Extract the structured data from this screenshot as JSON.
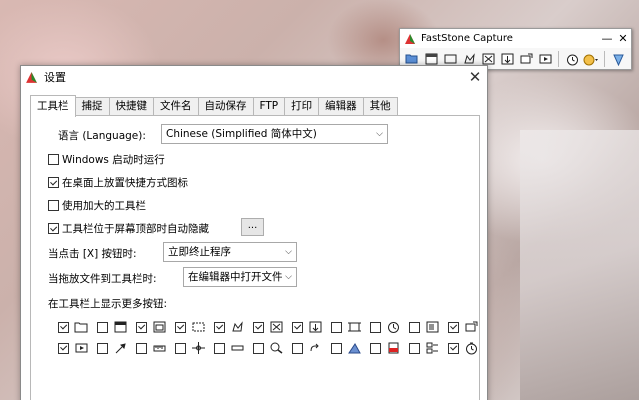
{
  "toolbar_window": {
    "title": "FastStone Capture",
    "min_btn": "—",
    "close_btn": "✕",
    "tools": [
      "open-icon",
      "capture-window-icon",
      "capture-rect-icon",
      "capture-freehand-icon",
      "capture-fullscreen-icon",
      "capture-scroll-icon",
      "capture-fixed-icon",
      "capture-video-icon",
      "timer-icon",
      "output-icon",
      "settings-icon"
    ]
  },
  "dialog": {
    "title": "设置",
    "close": "✕",
    "tabs": [
      "工具栏",
      "捕捉",
      "快捷键",
      "文件名",
      "自动保存",
      "FTP",
      "打印",
      "编辑器",
      "其他"
    ],
    "active_tab": 0,
    "language_label": "语言 (Language):",
    "language_value": "Chinese (Simplified 简体中文)",
    "options": [
      {
        "label": "Windows 启动时运行",
        "checked": false
      },
      {
        "label": "在桌面上放置快捷方式图标",
        "checked": true
      },
      {
        "label": "使用加大的工具栏",
        "checked": false
      },
      {
        "label": "工具栏位于屏幕顶部时自动隐藏",
        "checked": true
      }
    ],
    "more_button": "...",
    "click_x_label": "当点击 [X] 按钮时:",
    "click_x_value": "立即终止程序",
    "drag_label": "当拖放文件到工具栏时:",
    "drag_value": "在编辑器中打开文件",
    "more_buttons_label": "在工具栏上显示更多按钮:",
    "buttons_row1": [
      {
        "icon": "open-folder-icon",
        "checked": true
      },
      {
        "icon": "window-icon",
        "checked": false
      },
      {
        "icon": "object-icon",
        "checked": true
      },
      {
        "icon": "rect-select-icon",
        "checked": true
      },
      {
        "icon": "freehand-icon",
        "checked": true
      },
      {
        "icon": "fullscreen-icon",
        "checked": true
      },
      {
        "icon": "scroll-icon",
        "checked": true
      },
      {
        "icon": "fixed-region-icon",
        "checked": false
      },
      {
        "icon": "clock-icon",
        "checked": false
      },
      {
        "icon": "text-icon",
        "checked": false
      },
      {
        "icon": "send-icon",
        "checked": true
      }
    ],
    "buttons_row2": [
      {
        "icon": "video-icon",
        "checked": true
      },
      {
        "icon": "color-picker-icon",
        "checked": false
      },
      {
        "icon": "ruler-icon",
        "checked": false
      },
      {
        "icon": "crosshair-icon",
        "checked": false
      },
      {
        "icon": "screen-pen-icon",
        "checked": false
      },
      {
        "icon": "magnifier-icon",
        "checked": false
      },
      {
        "icon": "link-icon",
        "checked": false
      },
      {
        "icon": "triangle-icon",
        "checked": false
      },
      {
        "icon": "pdf-icon",
        "checked": false
      },
      {
        "icon": "split-icon",
        "checked": false
      },
      {
        "icon": "timer-icon",
        "checked": true
      }
    ]
  }
}
